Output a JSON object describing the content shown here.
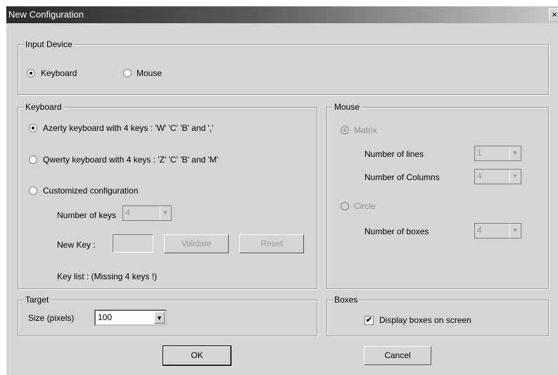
{
  "window": {
    "title": "New Configuration",
    "close": "×"
  },
  "input_device": {
    "legend": "Input Device",
    "options": [
      {
        "label": "Keyboard",
        "checked": true
      },
      {
        "label": "Mouse",
        "checked": false
      }
    ]
  },
  "keyboard": {
    "legend": "Keyboard",
    "azerty_label": "Azerty keyboard with 4 keys :  'W' 'C' 'B' and ','",
    "qwerty_label": "Qwerty keyboard with 4 keys : 'Z' 'C' 'B' and 'M'",
    "custom_label": "Customized configuration",
    "num_keys_label": "Number of keys",
    "num_keys_value": "4",
    "new_key_label": "New Key :",
    "new_key_value": "",
    "validate_label": "Validate",
    "reset_label": "Reset",
    "key_list_label": "Key list :  (Missing 4 keys !)"
  },
  "mouse": {
    "legend": "Mouse",
    "matrix_label": "Matrix",
    "lines_label": "Number of lines",
    "lines_value": "1",
    "columns_label": "Number of Columns",
    "columns_value": "4",
    "circle_label": "Circle",
    "boxes_label": "Number of boxes",
    "boxes_value": "4"
  },
  "target": {
    "legend": "Target",
    "size_label": "Size (pixels)",
    "size_value": "100"
  },
  "boxes": {
    "legend": "Boxes",
    "display_label": "Display boxes on screen",
    "display_checked": true,
    "check_glyph": "✔"
  },
  "buttons": {
    "ok": "OK",
    "cancel": "Cancel"
  },
  "icons": {
    "dropdown_arrow": "▼"
  }
}
